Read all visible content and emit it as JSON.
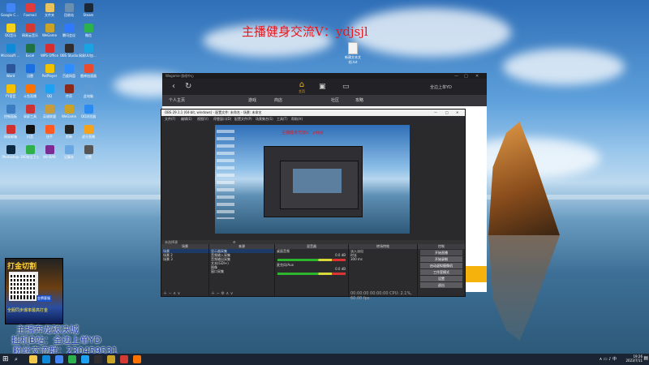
{
  "overlay": {
    "title": "主播健身交流V：ydjsjl",
    "subtitle1": "主播奔龙破决城",
    "subtitle2": "挂机B站：全边上单YD",
    "subtitle3": "粉丝交流群：230459531"
  },
  "promo": {
    "banner": "打金切割",
    "tag": "金牌客服",
    "line": "全服同步爆率最高打金"
  },
  "desktop_icons": [
    {
      "label": "Google Chrome",
      "color": "#4285f4"
    },
    {
      "label": "Foxmail",
      "color": "#e23b3b"
    },
    {
      "label": "文件夹",
      "color": "#e9c25b"
    },
    {
      "label": "回收站",
      "color": "#6b8fb0"
    },
    {
      "label": "Steam",
      "color": "#1b2838"
    },
    {
      "label": "QQ音乐",
      "color": "#f4d11a"
    },
    {
      "label": "网易云音乐",
      "color": "#d33a31"
    },
    {
      "label": "WeGame",
      "color": "#c9a227"
    },
    {
      "label": "腾讯会议",
      "color": "#2f79ff"
    },
    {
      "label": "微信",
      "color": "#2bb24c"
    },
    {
      "label": "Microsoft Edge",
      "color": "#0f8ad8"
    },
    {
      "label": "Excel",
      "color": "#1f7244"
    },
    {
      "label": "WPS Office",
      "color": "#d42e2e"
    },
    {
      "label": "OBS Studio",
      "color": "#302e31"
    },
    {
      "label": "网易UU加速器",
      "color": "#1aa3e3"
    },
    {
      "label": "Word",
      "color": "#2b579a"
    },
    {
      "label": "迅雷",
      "color": "#1b6fe0"
    },
    {
      "label": "PotPlayer",
      "color": "#f2c200"
    },
    {
      "label": "百度网盘",
      "color": "#2f8cff"
    },
    {
      "label": "雷神加速器",
      "color": "#e94b2b"
    },
    {
      "label": "YY语音",
      "color": "#f6c000"
    },
    {
      "label": "斗鱼直播",
      "color": "#ff7200"
    },
    {
      "label": "QQ",
      "color": "#1da1f2"
    },
    {
      "label": "传奇",
      "color": "#8a2a1a"
    },
    {
      "label": "此电脑",
      "color": "#5c9ad6"
    },
    {
      "label": "控制面板",
      "color": "#3c7cc0"
    },
    {
      "label": "录屏工具",
      "color": "#cc3333"
    },
    {
      "label": "英雄联盟",
      "color": "#c89b3c"
    },
    {
      "label": "WeGame",
      "color": "#c9a227"
    },
    {
      "label": "QQ浏览器",
      "color": "#2a8bf2"
    },
    {
      "label": "网易邮箱",
      "color": "#d03030"
    },
    {
      "label": "抖音",
      "color": "#111111"
    },
    {
      "label": "快手",
      "color": "#ff5a1f"
    },
    {
      "label": "剪映",
      "color": "#222222"
    },
    {
      "label": "虎牙直播",
      "color": "#f7a21b"
    },
    {
      "label": "Photoshop",
      "color": "#0b2942"
    },
    {
      "label": "360安全卫士",
      "color": "#2fb04a"
    },
    {
      "label": "WinRAR",
      "color": "#7b2b91"
    },
    {
      "label": "记事本",
      "color": "#6aa6e0"
    },
    {
      "label": "设置",
      "color": "#555555"
    }
  ],
  "desktop_file": {
    "label": "新建文本文档.txt"
  },
  "browser": {
    "caption": "Wegame-游戏中心",
    "home_label": "主页",
    "sub_items": [
      "个人主页",
      "游戏",
      "商店",
      "社区",
      "攻略"
    ],
    "window_min": "—",
    "window_max": "□",
    "window_close": "✕",
    "user": "全边上单YD"
  },
  "obs": {
    "title": "OBS 29.1.1 (64-bit, windows) - 配置文件: 未命名 - 场景: 未命名",
    "menu": [
      "文件(F)",
      "编辑(E)",
      "视图(V)",
      "停靠窗口(D)",
      "配置文件(P)",
      "场景集合(S)",
      "工具(T)",
      "帮助(H)"
    ],
    "preview_title": "主播健身交流V：ydjsjl",
    "status_label": "未选择源",
    "panels": {
      "scenes": {
        "header": "场景",
        "rows": [
          "场景",
          "场景 2",
          "场景 3"
        ]
      },
      "sources": {
        "header": "来源",
        "rows": [
          "显示器采集",
          "音频输入采集",
          "音频输出采集",
          "文本(GDI+)",
          "图像",
          "窗口采集"
        ]
      },
      "mixer": {
        "header": "混音器",
        "tracks": [
          "桌面音频",
          "麦克风/Aux"
        ],
        "db": [
          "0.0 dB",
          "0.0 dB"
        ]
      },
      "transitions": {
        "header": "转场特效",
        "type": "淡入淡出",
        "duration_label": "时长",
        "duration": "300 ms"
      },
      "controls": {
        "header": "控制",
        "buttons": [
          "开始直播",
          "开始录制",
          "启动虚拟摄像机",
          "工作室模式",
          "设置",
          "退出"
        ]
      }
    },
    "statusbar": "00:00:00  00:00:00  CPU: 2.1%, 60.00 fps"
  },
  "taskbar": {
    "start": "⊞",
    "search": "⌕",
    "tray": "∧  ▭  ♪  中",
    "time": "19:26",
    "date": "2023/7/11",
    "notify": "▤"
  }
}
